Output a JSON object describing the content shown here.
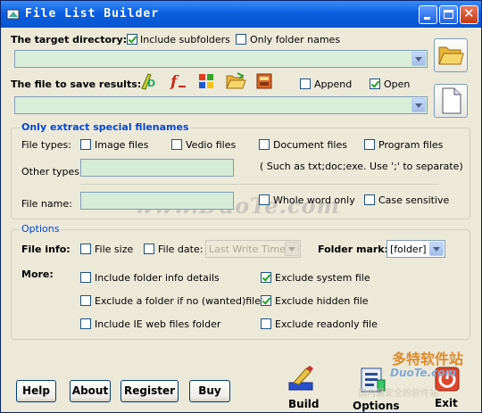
{
  "window": {
    "title": "File List Builder"
  },
  "target": {
    "label": "The target directory:",
    "include_subfolders": {
      "label": "Include subfolders",
      "checked": true
    },
    "only_folder_names": {
      "label": "Only folder names",
      "checked": false
    },
    "path_value": ""
  },
  "save": {
    "label": "The file to save results:",
    "format_icons": [
      "text-format-icon",
      "function-format-icon",
      "windows-format-icon",
      "folder-format-icon",
      "html-format-icon"
    ],
    "append": {
      "label": "Append",
      "checked": false
    },
    "open": {
      "label": "Open",
      "checked": true
    },
    "path_value": ""
  },
  "special": {
    "title": "Only extract special filenames",
    "file_types_label": "File types:",
    "image_files": {
      "label": "Image files",
      "checked": false
    },
    "vedio_files": {
      "label": "Vedio files",
      "checked": false
    },
    "document_files": {
      "label": "Document files",
      "checked": false
    },
    "program_files": {
      "label": "Program files",
      "checked": false
    },
    "other_types_label": "Other types:",
    "other_types_value": "",
    "hint": "( Such as  txt;doc;exe. Use ';' to separate)",
    "file_name_label": "File name:",
    "file_name_value": "",
    "whole_word_only": {
      "label": "Whole word only",
      "checked": false
    },
    "case_sensitive": {
      "label": "Case sensitive",
      "checked": false
    }
  },
  "options": {
    "title": "Options",
    "file_info_label": "File info:",
    "file_size": {
      "label": "File size",
      "checked": false
    },
    "file_date": {
      "label": "File date:",
      "checked": false
    },
    "date_select_value": "Last Write Time",
    "folder_mark_label": "Folder mark:",
    "folder_mark_value": "[folder]",
    "more_label": "More:",
    "include_folder_info": {
      "label": "Include folder info details",
      "checked": false
    },
    "exclude_folder_if_no": {
      "label": "Exclude a folder if no (wanted)file",
      "checked": false
    },
    "include_ie_web": {
      "label": "Include IE web files folder",
      "checked": false
    },
    "exclude_system": {
      "label": "Exclude system file",
      "checked": true
    },
    "exclude_hidden": {
      "label": "Exclude hidden file",
      "checked": true
    },
    "exclude_readonly": {
      "label": "Exclude readonly file",
      "checked": false
    }
  },
  "buttons": {
    "help": "Help",
    "about": "About",
    "register": "Register",
    "buy": "Buy"
  },
  "tools": {
    "build": "Build",
    "options": "Options",
    "exit": "Exit"
  },
  "watermark": {
    "center": "www.DuoTe.com",
    "corner_top": "多特软件站",
    "corner_brand": "DuoTe.com",
    "corner_bottom": "国内最安全的软件站"
  }
}
